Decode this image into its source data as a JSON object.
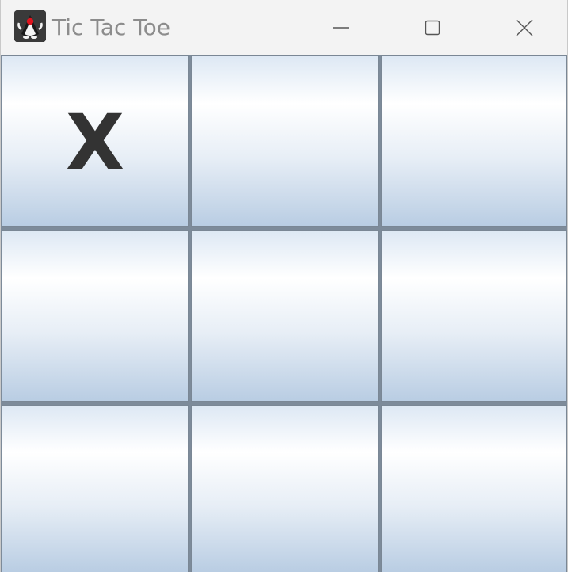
{
  "window": {
    "title": "Tic Tac Toe",
    "icon": "java-duke-icon"
  },
  "controls": {
    "minimize": "minimize-icon",
    "maximize": "maximize-icon",
    "close": "close-icon"
  },
  "board": {
    "cells": [
      {
        "value": "X"
      },
      {
        "value": ""
      },
      {
        "value": ""
      },
      {
        "value": ""
      },
      {
        "value": ""
      },
      {
        "value": ""
      },
      {
        "value": ""
      },
      {
        "value": ""
      },
      {
        "value": ""
      }
    ]
  },
  "colors": {
    "mark": "#333333",
    "title_text": "#8c8c8c",
    "grid_line": "#7d8b9a"
  }
}
